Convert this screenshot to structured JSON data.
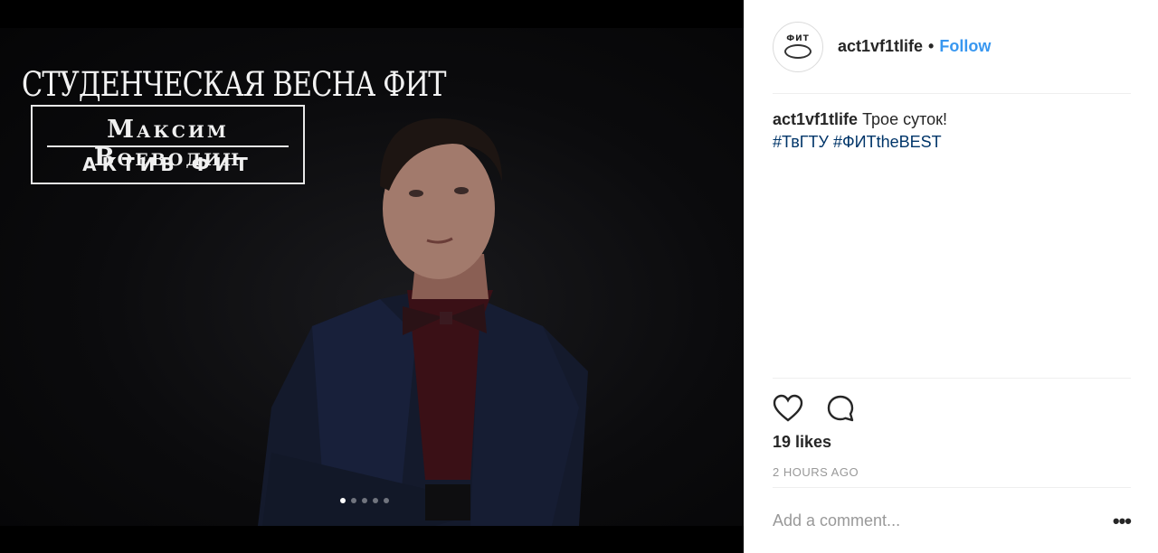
{
  "media": {
    "overlay": {
      "title": "СТУДЕНЧЕСКАЯ ВЕСНА ФИТ",
      "name": "Максим Воеводин",
      "subtitle": "АКТИВ ФИТ"
    },
    "carousel": {
      "count": 5,
      "active_index": 0
    }
  },
  "header": {
    "avatar_text": "ФИТ",
    "username": "act1vf1tlife",
    "separator": "•",
    "follow_label": "Follow"
  },
  "caption": {
    "username": "act1vf1tlife",
    "text": "Трое суток!",
    "hashtags": [
      "#ТвГТУ",
      "#ФИТtheBEST"
    ]
  },
  "actions": {
    "like_icon": "heart-icon",
    "comment_icon": "comment-bubble-icon",
    "likes_text": "19 likes",
    "time_text": "2 HOURS AGO"
  },
  "comment": {
    "placeholder": "Add a comment...",
    "more_label": "•••"
  },
  "colors": {
    "follow": "#3897f0",
    "hashtag": "#003569",
    "muted": "#999999"
  }
}
